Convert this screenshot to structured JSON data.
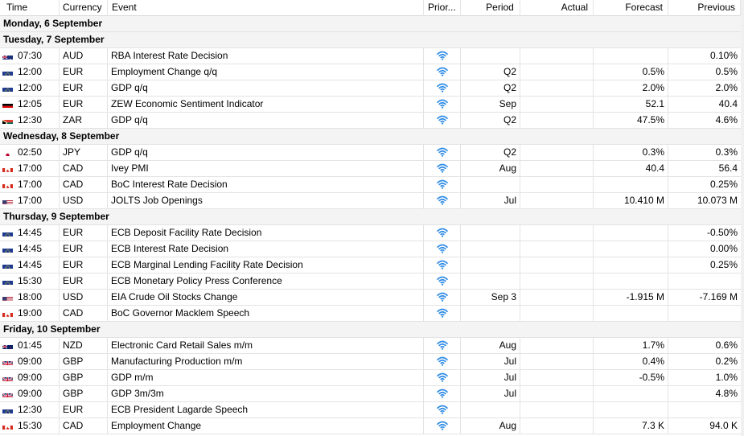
{
  "columns": {
    "time": "Time",
    "currency": "Currency",
    "event": "Event",
    "priority": "Prior...",
    "period": "Period",
    "actual": "Actual",
    "forecast": "Forecast",
    "previous": "Previous"
  },
  "days": [
    {
      "label": "Monday, 6 September",
      "events": []
    },
    {
      "label": "Tuesday, 7 September",
      "events": [
        {
          "time": "07:30",
          "flag": "AU",
          "currency": "AUD",
          "event": "RBA Interest Rate Decision",
          "period": "",
          "actual": "",
          "forecast": "",
          "previous": "0.10%"
        },
        {
          "time": "12:00",
          "flag": "EU",
          "currency": "EUR",
          "event": "Employment Change q/q",
          "period": "Q2",
          "actual": "",
          "forecast": "0.5%",
          "previous": "0.5%"
        },
        {
          "time": "12:00",
          "flag": "EU",
          "currency": "EUR",
          "event": "GDP q/q",
          "period": "Q2",
          "actual": "",
          "forecast": "2.0%",
          "previous": "2.0%"
        },
        {
          "time": "12:05",
          "flag": "DE",
          "currency": "EUR",
          "event": "ZEW Economic Sentiment Indicator",
          "period": "Sep",
          "actual": "",
          "forecast": "52.1",
          "previous": "40.4"
        },
        {
          "time": "12:30",
          "flag": "ZA",
          "currency": "ZAR",
          "event": "GDP q/q",
          "period": "Q2",
          "actual": "",
          "forecast": "47.5%",
          "previous": "4.6%"
        }
      ]
    },
    {
      "label": "Wednesday, 8 September",
      "events": [
        {
          "time": "02:50",
          "flag": "JP",
          "currency": "JPY",
          "event": "GDP q/q",
          "period": "Q2",
          "actual": "",
          "forecast": "0.3%",
          "previous": "0.3%"
        },
        {
          "time": "17:00",
          "flag": "CA",
          "currency": "CAD",
          "event": "Ivey PMI",
          "period": "Aug",
          "actual": "",
          "forecast": "40.4",
          "previous": "56.4"
        },
        {
          "time": "17:00",
          "flag": "CA",
          "currency": "CAD",
          "event": "BoC Interest Rate Decision",
          "period": "",
          "actual": "",
          "forecast": "",
          "previous": "0.25%"
        },
        {
          "time": "17:00",
          "flag": "US",
          "currency": "USD",
          "event": "JOLTS Job Openings",
          "period": "Jul",
          "actual": "",
          "forecast": "10.410 M",
          "previous": "10.073 M"
        }
      ]
    },
    {
      "label": "Thursday, 9 September",
      "events": [
        {
          "time": "14:45",
          "flag": "EU",
          "currency": "EUR",
          "event": "ECB Deposit Facility Rate Decision",
          "period": "",
          "actual": "",
          "forecast": "",
          "previous": "-0.50%"
        },
        {
          "time": "14:45",
          "flag": "EU",
          "currency": "EUR",
          "event": "ECB Interest Rate Decision",
          "period": "",
          "actual": "",
          "forecast": "",
          "previous": "0.00%"
        },
        {
          "time": "14:45",
          "flag": "EU",
          "currency": "EUR",
          "event": "ECB Marginal Lending Facility Rate Decision",
          "period": "",
          "actual": "",
          "forecast": "",
          "previous": "0.25%"
        },
        {
          "time": "15:30",
          "flag": "EU",
          "currency": "EUR",
          "event": "ECB Monetary Policy Press Conference",
          "period": "",
          "actual": "",
          "forecast": "",
          "previous": ""
        },
        {
          "time": "18:00",
          "flag": "US",
          "currency": "USD",
          "event": "EIA Crude Oil Stocks Change",
          "period": "Sep 3",
          "actual": "",
          "forecast": "-1.915 M",
          "previous": "-7.169 M"
        },
        {
          "time": "19:00",
          "flag": "CA",
          "currency": "CAD",
          "event": "BoC Governor Macklem Speech",
          "period": "",
          "actual": "",
          "forecast": "",
          "previous": ""
        }
      ]
    },
    {
      "label": "Friday, 10 September",
      "events": [
        {
          "time": "01:45",
          "flag": "NZ",
          "currency": "NZD",
          "event": "Electronic Card Retail Sales m/m",
          "period": "Aug",
          "actual": "",
          "forecast": "1.7%",
          "previous": "0.6%"
        },
        {
          "time": "09:00",
          "flag": "GB",
          "currency": "GBP",
          "event": "Manufacturing Production m/m",
          "period": "Jul",
          "actual": "",
          "forecast": "0.4%",
          "previous": "0.2%"
        },
        {
          "time": "09:00",
          "flag": "GB",
          "currency": "GBP",
          "event": "GDP m/m",
          "period": "Jul",
          "actual": "",
          "forecast": "-0.5%",
          "previous": "1.0%"
        },
        {
          "time": "09:00",
          "flag": "GB",
          "currency": "GBP",
          "event": "GDP 3m/3m",
          "period": "Jul",
          "actual": "",
          "forecast": "",
          "previous": "4.8%"
        },
        {
          "time": "12:30",
          "flag": "EU",
          "currency": "EUR",
          "event": "ECB President Lagarde Speech",
          "period": "",
          "actual": "",
          "forecast": "",
          "previous": ""
        },
        {
          "time": "15:30",
          "flag": "CA",
          "currency": "CAD",
          "event": "Employment Change",
          "period": "Aug",
          "actual": "",
          "forecast": "7.3 K",
          "previous": "94.0 K"
        }
      ]
    }
  ],
  "priority_icon": "signal-wifi-icon",
  "colors": {
    "priority_icon": "#2e8be6",
    "day_row_bg": "#f4f4f4",
    "grid": "#e3e3e3"
  }
}
